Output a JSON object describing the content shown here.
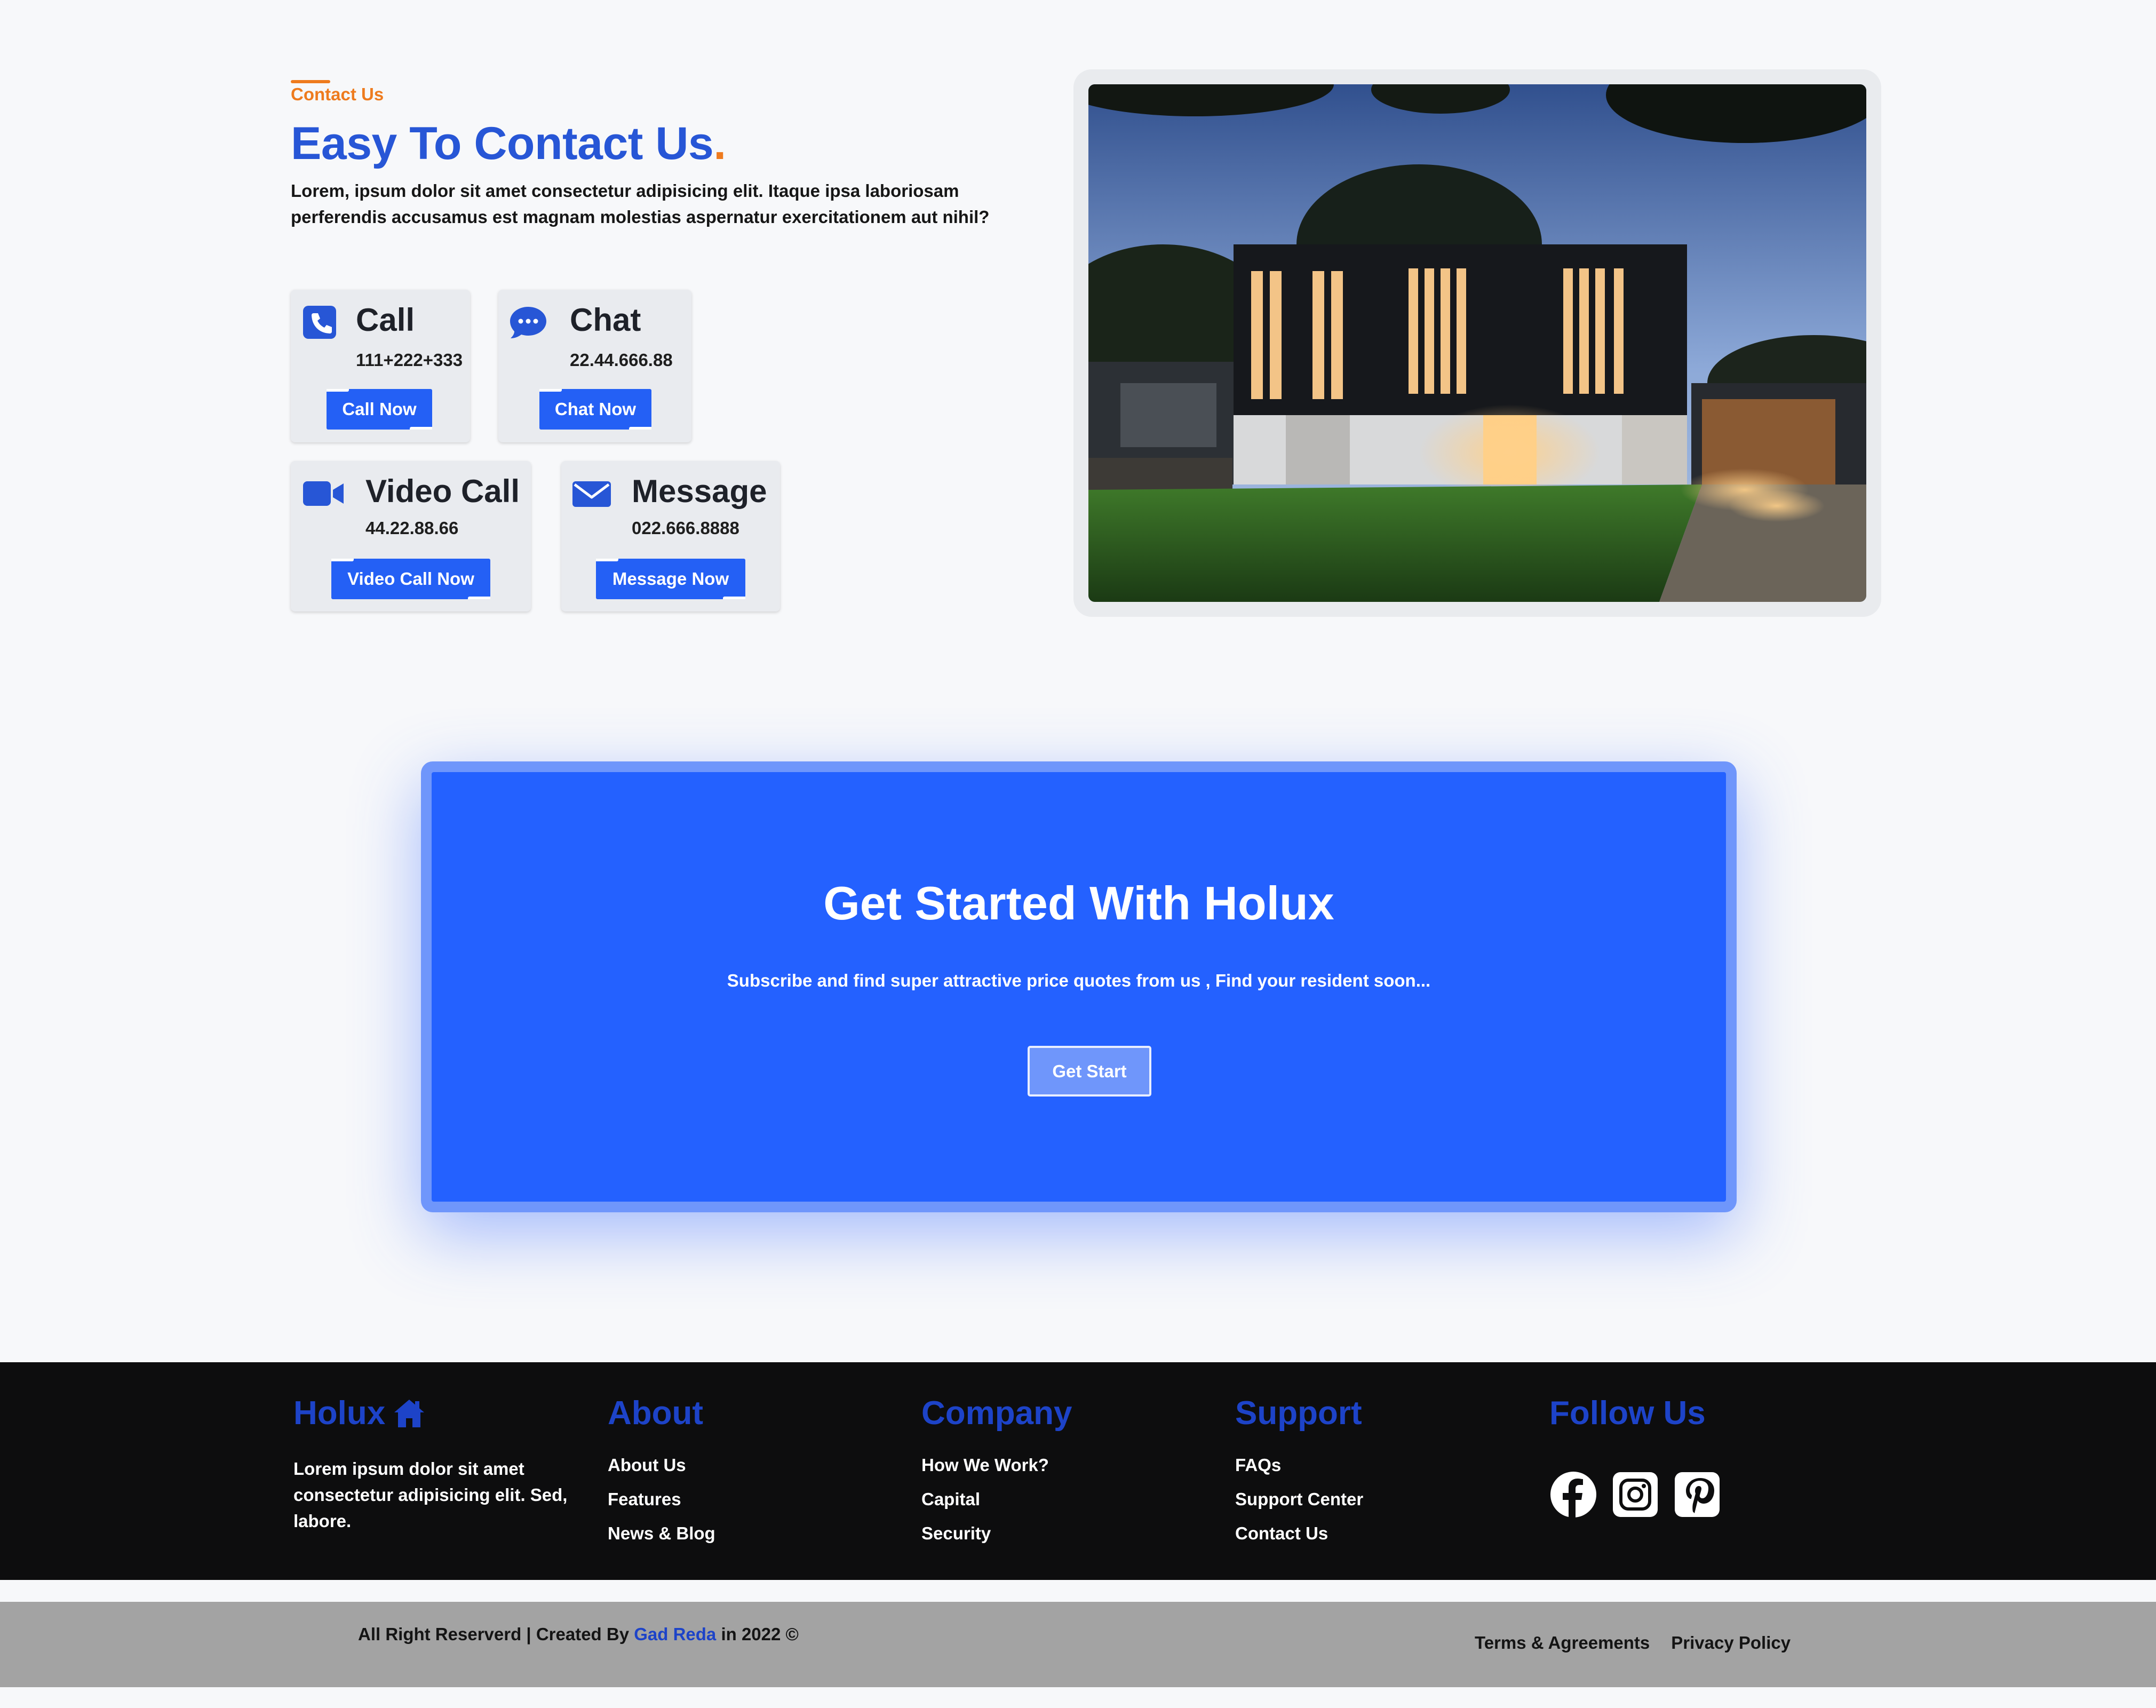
{
  "contact": {
    "eyebrow": "Contact Us",
    "headline": "Easy To Contact Us",
    "headline_dot": ".",
    "description": "Lorem, ipsum dolor sit amet consectetur adipisicing elit. Itaque ipsa laboriosam perferendis accusamus est magnam molestias aspernatur exercitationem aut nihil?",
    "cards": [
      {
        "icon": "phone-icon",
        "title": "Call",
        "number": "111+222+333",
        "button": "Call Now"
      },
      {
        "icon": "chat-bubble-icon",
        "title": "Chat",
        "number": "22.44.666.88",
        "button": "Chat Now"
      },
      {
        "icon": "video-camera-icon",
        "title": "Video Call",
        "number": "44.22.88.66",
        "button": "Video Call Now"
      },
      {
        "icon": "envelope-icon",
        "title": "Message",
        "number": "022.666.8888",
        "button": "Message Now"
      }
    ]
  },
  "cta": {
    "title": "Get Started With Holux",
    "subtitle": "Subscribe and find super attractive price quotes from us , Find your resident soon...",
    "button": "Get Start"
  },
  "footer": {
    "brand": "Holux",
    "brand_icon": "house-icon",
    "brand_description": "Lorem ipsum dolor sit amet consectetur adipisicing elit. Sed, labore.",
    "about": {
      "title": "About",
      "links": [
        "About Us",
        "Features",
        "News & Blog"
      ]
    },
    "company": {
      "title": "Company",
      "links": [
        "How We Work?",
        "Capital",
        "Security"
      ]
    },
    "support": {
      "title": "Support",
      "links": [
        "FAQs",
        "Support Center",
        "Contact Us"
      ]
    },
    "follow": {
      "title": "Follow Us",
      "icons": [
        "facebook-icon",
        "instagram-icon",
        "pinterest-icon"
      ]
    }
  },
  "bottom": {
    "copyright_prefix": "All Right Reserverd | Created By ",
    "author": "Gad Reda",
    "copyright_suffix": " in 2022 ©",
    "links": [
      "Terms & Agreements",
      "Privacy Policy"
    ]
  },
  "colors": {
    "accent_blue": "#2460f5",
    "heading_blue": "#2756d6",
    "accent_orange": "#ee7b1e",
    "footer_bg": "#0d0d0e",
    "bottom_bar_bg": "#a3a3a3"
  }
}
